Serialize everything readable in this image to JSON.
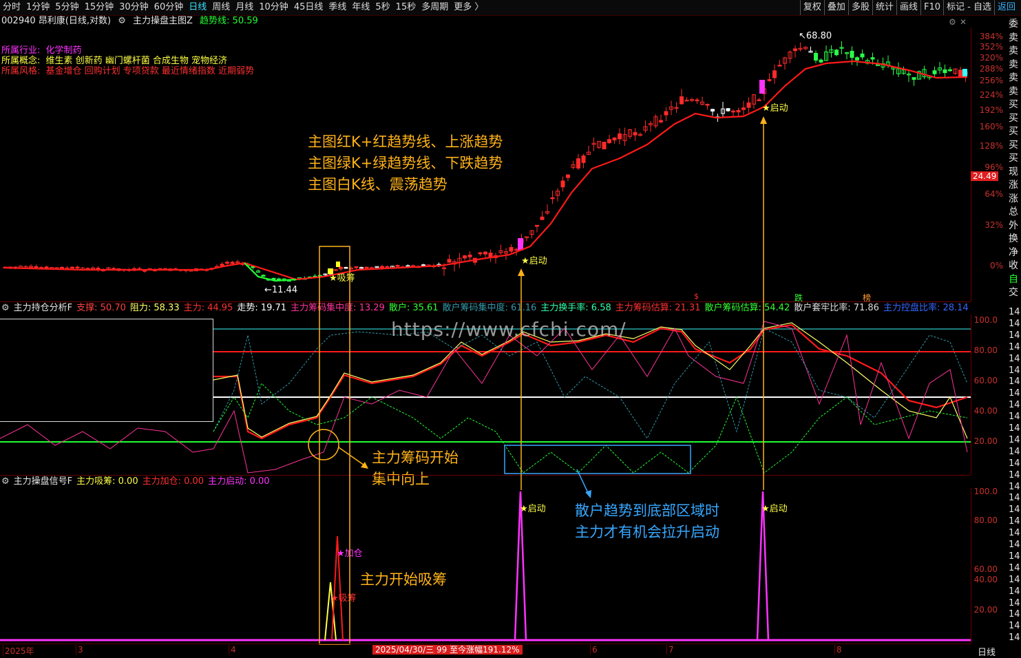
{
  "toolbar": {
    "periods": [
      "分时",
      "1分钟",
      "5分钟",
      "15分钟",
      "30分钟",
      "60分钟",
      "日线",
      "周线",
      "月线",
      "10分钟",
      "45日线",
      "季线",
      "年线",
      "5秒",
      "15秒",
      "多周期",
      "更多 〉"
    ],
    "active_period": "日线",
    "right_items": [
      "复权",
      "叠加",
      "多股",
      "统计",
      "画线",
      "F10",
      "标记 - 自选",
      "返回"
    ]
  },
  "chart_header": {
    "code_name": "002940 昂利康(日线,对数)",
    "indicator": "主力操盘主图Z",
    "trend_label": "趋势线: 50.59"
  },
  "info": {
    "industry_label": "所属行业:",
    "industry_value": "化学制药",
    "concept_label": "所属概念:",
    "concept_value": "维生素 创新药 幽门螺杆菌 合成生物 宠物经济",
    "style_label": "所属风格:",
    "style_value": "基金增仓 回购计划 专项贷款 最近情绪指数 近期弱势"
  },
  "main_chart": {
    "right_axis": [
      "384%",
      "352%",
      "320%",
      "288%",
      "256%",
      "224%",
      "192%",
      "160%",
      "128%",
      "96%",
      "64%",
      "32%",
      "0%"
    ],
    "current_price": "24.49",
    "high_label": "68.80",
    "low_label": "11.44",
    "start_labels": [
      "★启动",
      "★启动"
    ],
    "absorb_label": "★吸筹",
    "event_markers": [
      "跌",
      "榜"
    ],
    "bull_color": "#ff2b2b",
    "bear_color": "#2bff4a",
    "neutral_color": "#ffffff",
    "trend_up_color": "#ff1a1a",
    "trend_down_color": "#22ff33"
  },
  "annotations": {
    "main_lines": [
      "主图红K+红趋势线、上涨趋势",
      "主图绿K+绿趋势线、下跌趋势",
      "主图白K线、震荡趋势"
    ],
    "chip_lines": [
      "主力筹码开始",
      "集中向上"
    ],
    "retail_lines": [
      "散户趋势到底部区域时",
      "主力才有机会拉升启动"
    ],
    "absorb_text": "主力开始吸筹"
  },
  "panel2": {
    "title": "主力持仓分析F",
    "items": [
      {
        "text": "支撑: 50.70",
        "color": "#ff4040"
      },
      {
        "text": "阻力: 58.33",
        "color": "#ffff66"
      },
      {
        "text": "主力: 44.95",
        "color": "#ff3030"
      },
      {
        "text": "走势: 19.71",
        "color": "#ffffff"
      },
      {
        "text": "主力筹码集中度: 13.29",
        "color": "#ff3399"
      },
      {
        "text": "散户: 35.61",
        "color": "#33ff33"
      },
      {
        "text": "散户筹码集中度: 61.16",
        "color": "#3399aa"
      },
      {
        "text": "主力换手率: 6.58",
        "color": "#33ffaa"
      },
      {
        "text": "主力筹码估算: 21.31",
        "color": "#ff3030"
      },
      {
        "text": "散户筹码估算: 54.42",
        "color": "#33ff33"
      },
      {
        "text": "散户套牢比率: 71.86",
        "color": "#dddddd"
      },
      {
        "text": "主力控盘比率: 28.14",
        "color": "#3366ff"
      }
    ],
    "y_ticks": [
      "100.0",
      "80.00",
      "60.00",
      "40.00",
      "20.00"
    ]
  },
  "panel3": {
    "title": "主力操盘信号F",
    "items": [
      {
        "text": "主力吸筹: 0.00",
        "color": "#ffff44"
      },
      {
        "text": "主力加仓: 0.00",
        "color": "#ff3030"
      },
      {
        "text": "主力启动: 0.00",
        "color": "#ff33ff"
      }
    ],
    "y_ticks": [
      "100.0",
      "80.00",
      "60.00",
      "40.00",
      "20.00"
    ],
    "signal_labels": {
      "start1": "★启动",
      "start2": "★启动",
      "add": "★加仓",
      "absorb": "★吸筹"
    }
  },
  "watermark": "https://www.cfchi.com/",
  "bottom": {
    "months": [
      "2025年",
      "3",
      "4",
      "5",
      "6",
      "7",
      "8"
    ],
    "date_info": "2025/04/30/三 99 至今涨幅191.12%",
    "period_tab": "日线"
  },
  "side_panel": [
    "委",
    "卖",
    "卖",
    "卖",
    "卖",
    "卖",
    "买",
    "买",
    "买",
    "买",
    "买",
    "现",
    "涨",
    "涨",
    "总",
    "外",
    "换",
    "净",
    "收",
    "自",
    "交"
  ],
  "side_panel2": [
    "14",
    "14",
    "14",
    "14",
    "14",
    "14",
    "14",
    "14",
    "14",
    "14",
    "14",
    "14",
    "14",
    "14",
    "14",
    "14",
    "14",
    "14",
    "14",
    "14",
    "14",
    "14",
    "14",
    "14",
    "14",
    "14",
    "14",
    "14",
    "14"
  ]
}
